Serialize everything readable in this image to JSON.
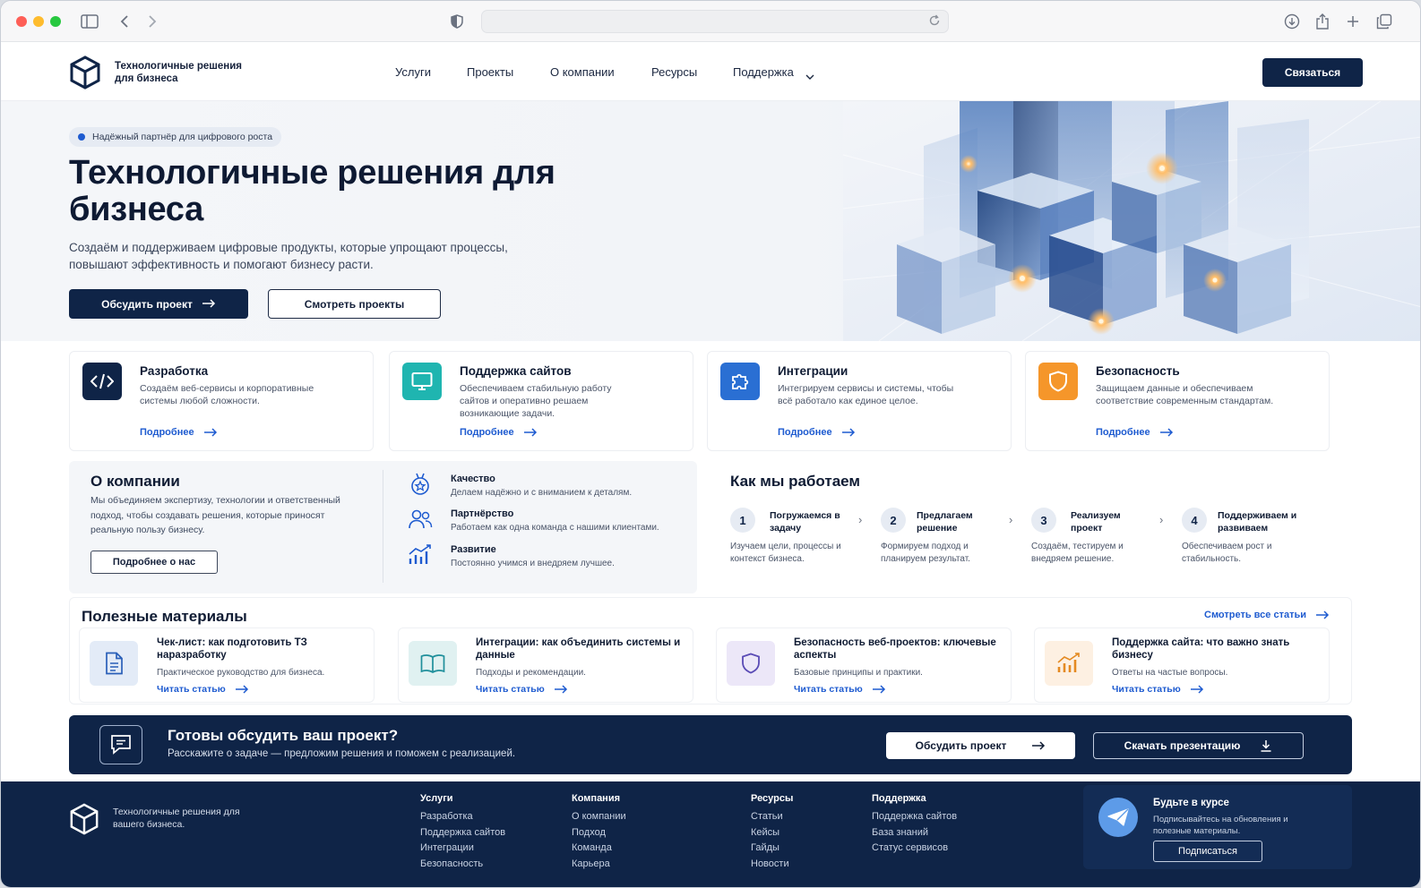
{
  "header": {
    "logo_text": "Технологичные решения для бизнеса",
    "nav": [
      "Услуги",
      "Проекты",
      "О компании",
      "Ресурсы",
      "Поддержка"
    ],
    "contact_label": "Связаться"
  },
  "hero": {
    "badge": "Надёжный партнёр для цифрового роста",
    "title": "Технологичные решения для бизнеса",
    "subtitle": "Создаём и поддерживаем цифровые продукты, которые упрощают процессы, повышают эффективность и помогают бизнесу расти.",
    "primary_button": "Обсудить проект",
    "secondary_button": "Смотреть проекты"
  },
  "services": [
    {
      "title": "Разработка",
      "desc": "Создаём веб-сервисы и корпоративные системы любой сложности.",
      "more": "Подробнее",
      "icon": "code-icon"
    },
    {
      "title": "Поддержка сайтов",
      "desc": "Обеспечиваем стабильную работу сайтов и оперативно решаем возникающие задачи.",
      "more": "Подробнее",
      "icon": "monitor-icon"
    },
    {
      "title": "Интеграции",
      "desc": "Интегрируем сервисы и системы, чтобы всё работало как единое целое.",
      "more": "Подробнее",
      "icon": "puzzle-icon"
    },
    {
      "title": "Безопасность",
      "desc": "Защищаем данные и обеспечиваем соответствие современным стандартам.",
      "more": "Подробнее",
      "icon": "shield-icon"
    }
  ],
  "about": {
    "title": "О компании",
    "desc": "Мы объединяем экспертизу, технологии и ответственный подход, чтобы создавать решения, которые приносят реальную пользу бизнесу.",
    "button": "Подробнее о нас",
    "values": [
      {
        "title": "Качество",
        "desc": "Делаем надёжно и с вниманием к деталям.",
        "icon": "medal-icon"
      },
      {
        "title": "Партнёрство",
        "desc": "Работаем как одна команда с нашими клиентами.",
        "icon": "people-icon"
      },
      {
        "title": "Развитие",
        "desc": "Постоянно учимся и внедряем лучшее.",
        "icon": "growth-chart-icon"
      }
    ]
  },
  "how": {
    "title": "Как мы работаем",
    "steps": [
      {
        "num": "1",
        "title": "Погружаемся в задачу",
        "desc": "Изучаем цели, процессы и контекст бизнеса."
      },
      {
        "num": "2",
        "title": "Предлагаем решение",
        "desc": "Формируем подход и планируем результат."
      },
      {
        "num": "3",
        "title": "Реализуем проект",
        "desc": "Создаём, тестируем и внедряем решение."
      },
      {
        "num": "4",
        "title": "Поддерживаем и развиваем",
        "desc": "Обеспечиваем рост и стабильность."
      }
    ]
  },
  "materials": {
    "title": "Полезные материалы",
    "all_link": "Смотреть все статьи",
    "articles": [
      {
        "title": "Чек-лист: как подготовить ТЗ наразработку",
        "desc": "Практическое руководство для бизнеса.",
        "read": "Читать статью",
        "icon": "document-icon"
      },
      {
        "title": "Интеграции: как объединить системы и данные",
        "desc": "Подходы и рекомендации.",
        "read": "Читать статью",
        "icon": "book-icon"
      },
      {
        "title": "Безопасность веб-проектов: ключевые аспекты",
        "desc": "Базовые принципы и практики.",
        "read": "Читать статью",
        "icon": "shield-icon"
      },
      {
        "title": "Поддержка сайта: что важно знать бизнесу",
        "desc": "Ответы на частые вопросы.",
        "read": "Читать статью",
        "icon": "bar-chart-icon"
      }
    ]
  },
  "cta": {
    "title": "Готовы обсудить ваш проект?",
    "subtitle": "Расскажите о задаче — предложим решения и поможем с реализацией.",
    "primary_button": "Обсудить проект",
    "secondary_button": "Скачать презентацию"
  },
  "footer": {
    "tagline": "Технологичные решения для вашего бизнеса.",
    "columns": [
      {
        "title": "Услуги",
        "links": [
          "Разработка",
          "Поддержка сайтов",
          "Интеграции",
          "Безопасность"
        ]
      },
      {
        "title": "Компания",
        "links": [
          "О компании",
          "Подход",
          "Команда",
          "Карьера"
        ]
      },
      {
        "title": "Ресурсы",
        "links": [
          "Статьи",
          "Кейсы",
          "Гайды",
          "Новости"
        ]
      },
      {
        "title": "Поддержка",
        "links": [
          "Поддержка сайтов",
          "База знаний",
          "Статус сервисов"
        ]
      }
    ],
    "newsletter": {
      "title": "Будьте в курсе",
      "subtitle": "Подписывайтесь на обновления и полезные материалы.",
      "button": "Подписаться"
    }
  },
  "colors": {
    "navy": "#0f2447",
    "accent_blue": "#1e5bd0",
    "teal": "#1fb5b0",
    "orange": "#f5962a"
  }
}
